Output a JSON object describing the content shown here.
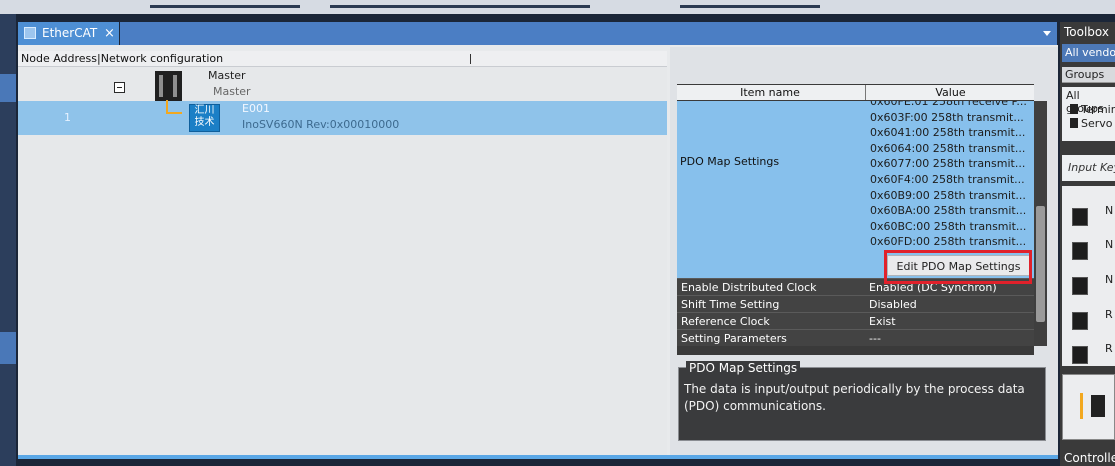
{
  "tab": {
    "label": "EtherCAT",
    "close": "×"
  },
  "tree": {
    "header": "Node Address|Network configuration",
    "master": {
      "title": "Master",
      "subtitle": "Master"
    },
    "slave": {
      "node": "1",
      "name": "E001",
      "model": "InoSV660N Rev:0x00010000",
      "logo_line1": "汇川",
      "logo_line2": "技术"
    }
  },
  "grid": {
    "col_item": "Item name",
    "col_value": "Value",
    "pdo_label": "PDO Map Settings",
    "pdo_entries": [
      "0x60FE:01 258th receive P...",
      "0x603F:00 258th transmit...",
      "0x6041:00 258th transmit...",
      "0x6064:00 258th transmit...",
      "0x6077:00 258th transmit...",
      "0x60F4:00 258th transmit...",
      "0x60B9:00 258th transmit...",
      "0x60BA:00 258th transmit...",
      "0x60BC:00 258th transmit...",
      "0x60FD:00 258th transmit..."
    ],
    "edit_button": "Edit PDO Map Settings",
    "rows": [
      {
        "key": "Enable Distributed Clock",
        "value": "Enabled (DC Synchron)"
      },
      {
        "key": "Shift Time Setting",
        "value": "Disabled"
      },
      {
        "key": "Reference Clock",
        "value": "Exist"
      },
      {
        "key": "Setting Parameters",
        "value": "---"
      }
    ]
  },
  "description": {
    "title": "PDO Map Settings",
    "text": "The data is input/output periodically by the process data (PDO) communications."
  },
  "toolbox": {
    "title": "Toolbox",
    "vendor": "All vendors",
    "groups": "Groups",
    "groups_all": "All groups",
    "group_items": [
      "Terminal",
      "Servo"
    ],
    "input_keyword": "Input Keyword",
    "items": [
      "N",
      "N",
      "N",
      "R",
      "R"
    ],
    "controller": "Controller"
  }
}
